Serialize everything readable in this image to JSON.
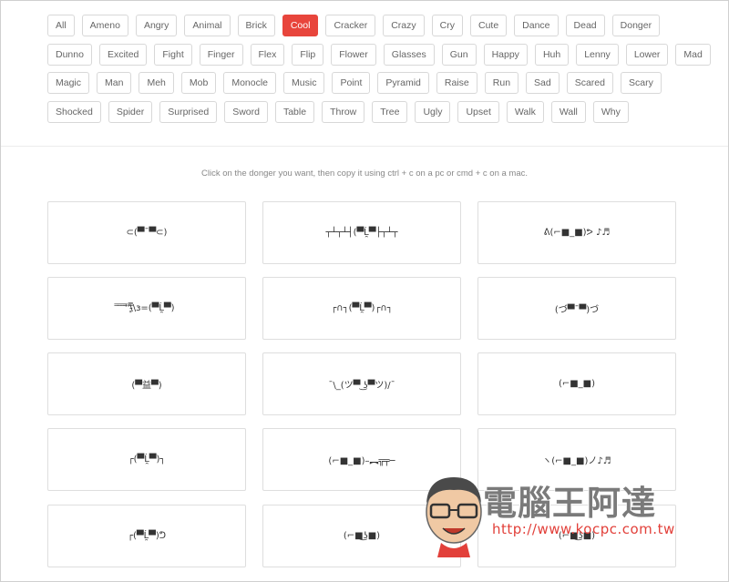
{
  "tag_rows": [
    [
      "All",
      "Ameno",
      "Angry",
      "Animal",
      "Brick",
      "Cool",
      "Cracker",
      "Crazy",
      "Cry",
      "Cute",
      "Dance",
      "Dead",
      "Donger"
    ],
    [
      "Dunno",
      "Excited",
      "Fight",
      "Finger",
      "Flex",
      "Flip",
      "Flower",
      "Glasses",
      "Gun",
      "Happy",
      "Huh",
      "Lenny",
      "Lower",
      "Mad"
    ],
    [
      "Magic",
      "Man",
      "Meh",
      "Mob",
      "Monocle",
      "Music",
      "Point",
      "Pyramid",
      "Raise",
      "Run",
      "Sad",
      "Scared",
      "Scary"
    ],
    [
      "Shocked",
      "Spider",
      "Surprised",
      "Sword",
      "Table",
      "Throw",
      "Tree",
      "Ugly",
      "Upset",
      "Walk",
      "Wall",
      "Why"
    ]
  ],
  "active_tag": "Cool",
  "colors": {
    "active_tag_bg": "#e8453c",
    "watermark_text": "#7a7a7a",
    "watermark_url": "#e2403a"
  },
  "instructions": "Click on the donger you want, then copy it using ctrl + c on a pc or cmd + c on a mac.",
  "dongers": [
    "⊂(▀¯▀⊂)",
    "┬┴┬┴┤(▀̿Ĺ̯▀̿├┬┴┬",
    "ᕕ(⌐■_■)ᕗ ♪♬",
    "̿ ̿ ̿'̿'\\̵͇̿̿\\з=(▀̿Ĺ̯▀̿)",
    "┌∩┐(▀̿Ĺ̯▀̿)┌∩┐",
    "(づ▀¯▀)づ",
    "(▀益▀)",
    "¯\\_(ツ▀ ͜ʖ▀ツ)/¯",
    "(⌐■_■)",
    "┌(▀Ĺ̯▀)┐",
    "(⌐■_■)–︻╦╤─",
    "ヽ(⌐■_■)ノ♪♬",
    "┌(▀̿Ĺ̯▀̿)ᕤ",
    "(⌐■͜ʖ■)",
    "(⌐■͜ʖ■)"
  ],
  "watermark": {
    "title": "電腦王阿達",
    "url": "http://www.kocpc.com.tw"
  }
}
